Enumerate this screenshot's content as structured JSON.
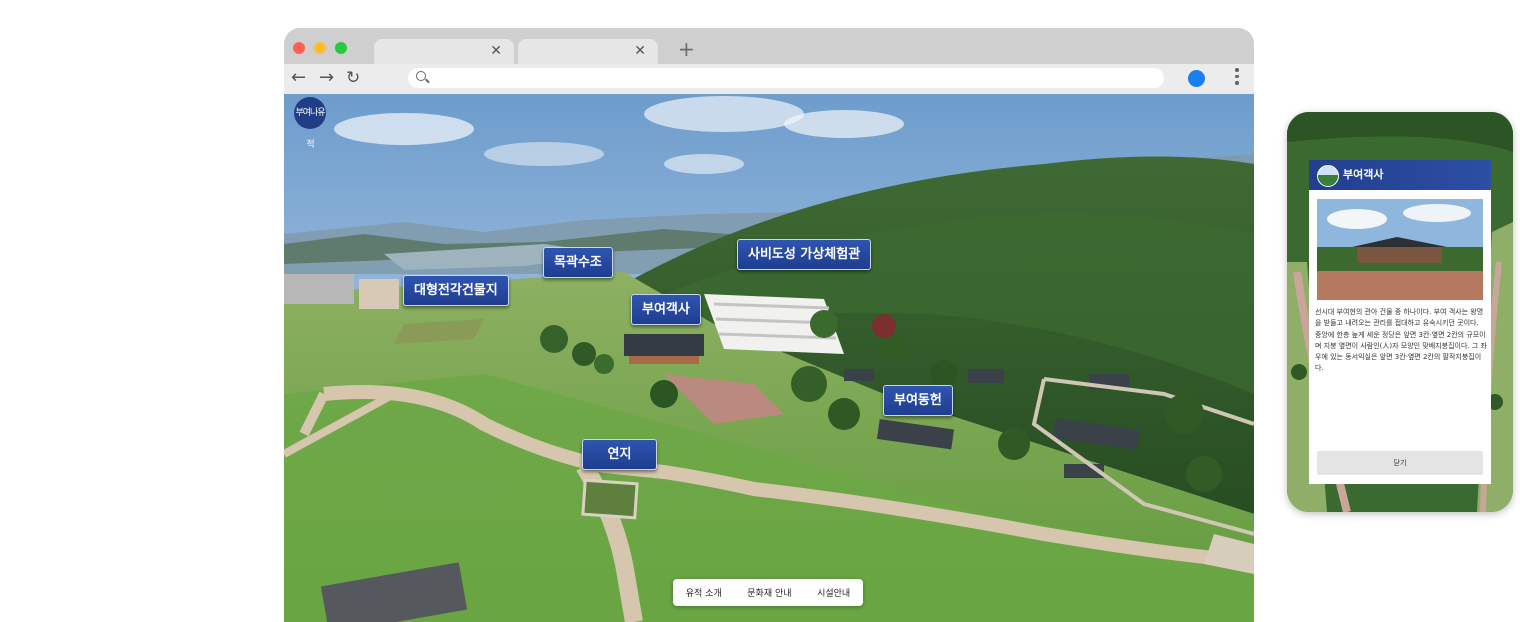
{
  "browser": {
    "tabs": [
      {
        "title": "",
        "close_icon": "close-icon"
      },
      {
        "title": "",
        "close_icon": "close-icon"
      }
    ],
    "new_tab_icon": "plus-icon",
    "address_bar": {
      "value": "",
      "placeholder": ""
    },
    "nav_icons": [
      "arrow-left-icon",
      "arrow-right-icon",
      "reload-icon"
    ],
    "traffic_light_colors": [
      "#ff5f57",
      "#febc2e",
      "#28c840"
    ],
    "profile_color": "#1a7ff0"
  },
  "site": {
    "logo_text": "부여나유적",
    "map_labels": [
      {
        "id": "sabi",
        "text": "사비도성 가상체험관"
      },
      {
        "id": "mokgwak",
        "text": "목곽수조"
      },
      {
        "id": "daehyeong",
        "text": "대형전각건물지"
      },
      {
        "id": "gaeksa",
        "text": "부여객사"
      },
      {
        "id": "donghyeon",
        "text": "부여동헌"
      },
      {
        "id": "yeonji",
        "text": "연지"
      }
    ],
    "bottom_menu": [
      "유적 소개",
      "문화재 안내",
      "시설안내"
    ],
    "label_color": "#2446a0"
  },
  "mobile": {
    "modal": {
      "title": "부여객사",
      "description": "선시대 부여현의 관아 건물 중 하나이다. 부여 객사는 왕명을 받들고 내려오는 관리를 접대하고 유숙시키던 곳이다. 중앙에 한층 높게 세운 정당은 앞면 3칸·옆면 2칸의 규모이며 지붕 옆면이 사람인(人)자 모양인 맞배지붕집이다. 그 좌우에 있는 동서익실은 앞면 3칸·옆면 2칸의 팔작지붕집이다.",
      "close_label": "닫기"
    }
  }
}
